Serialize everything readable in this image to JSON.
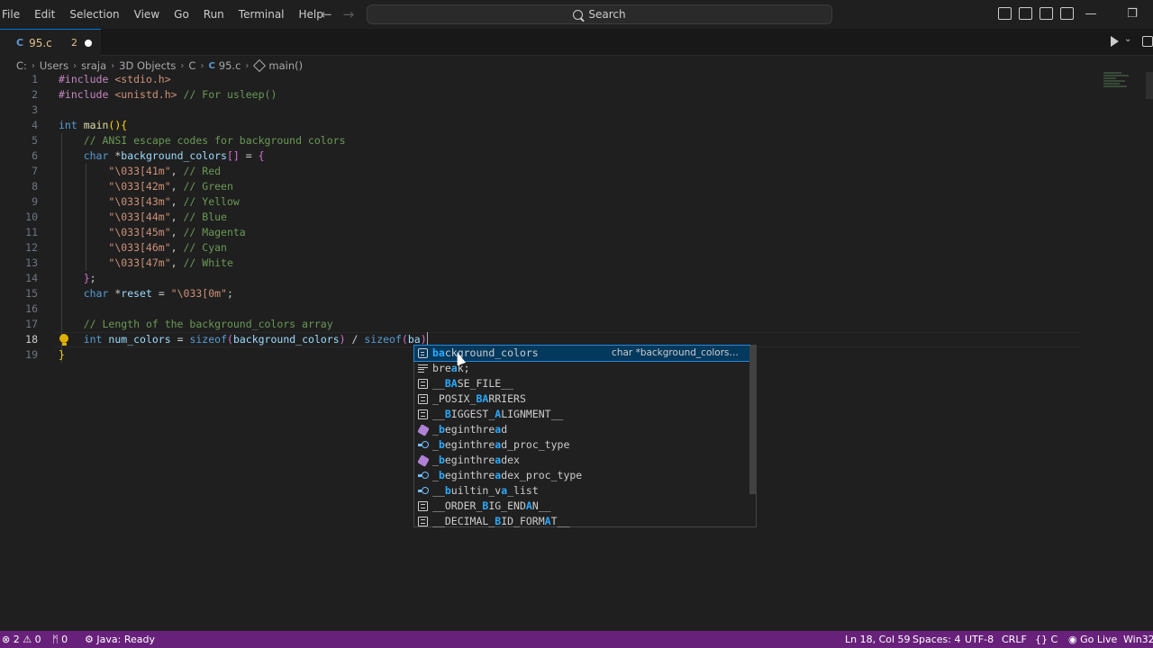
{
  "menu": [
    "File",
    "Edit",
    "Selection",
    "View",
    "Go",
    "Run",
    "Terminal",
    "Help"
  ],
  "search_label": "Search",
  "tab": {
    "icon": "C",
    "name": "95.c",
    "problems": "2"
  },
  "breadcrumb": [
    "C:",
    "Users",
    "sraja",
    "3D Objects",
    "C",
    "95.c",
    "main()"
  ],
  "breadcrumb_file_icon": "C",
  "editor": {
    "line_numbers": [
      "1",
      "2",
      "3",
      "4",
      "5",
      "6",
      "7",
      "8",
      "9",
      "10",
      "11",
      "12",
      "13",
      "14",
      "15",
      "16",
      "17",
      "18",
      "19"
    ],
    "active_line": "18"
  },
  "suggest": {
    "items": [
      {
        "icon": "variable-icon",
        "label": "background_colors",
        "detail": "char *background_colors…"
      },
      {
        "icon": "keyword-icon",
        "label": "break;"
      },
      {
        "icon": "text-icon",
        "label": "__BASE_FILE__"
      },
      {
        "icon": "text-icon",
        "label": "_POSIX_BARRIERS"
      },
      {
        "icon": "text-icon",
        "label": "__BIGGEST_ALIGNMENT__"
      },
      {
        "icon": "function-icon",
        "label": "_beginthread"
      },
      {
        "icon": "field-icon",
        "label": "_beginthread_proc_type"
      },
      {
        "icon": "function-icon",
        "label": "_beginthreadex"
      },
      {
        "icon": "field-icon",
        "label": "_beginthreadex_proc_type"
      },
      {
        "icon": "field-icon",
        "label": "__builtin_va_list"
      },
      {
        "icon": "text-icon",
        "label": "__ORDER_BIG_ENDIAN__"
      },
      {
        "icon": "text-icon",
        "label": "__DECIMAL_BID_FORMAT__"
      }
    ]
  },
  "status": {
    "errors": "2",
    "warnings": "0",
    "ports": "0",
    "java": "Java: Ready",
    "position": "Ln 18, Col 59",
    "spaces": "Spaces: 4",
    "encoding": "UTF-8",
    "eol": "CRLF",
    "language": "C",
    "golive": "Go Live",
    "platform": "Win32"
  },
  "colors": {
    "statusbar": "#68217a",
    "editor_bg": "#1f1f1f",
    "accent": "#0078d4"
  }
}
